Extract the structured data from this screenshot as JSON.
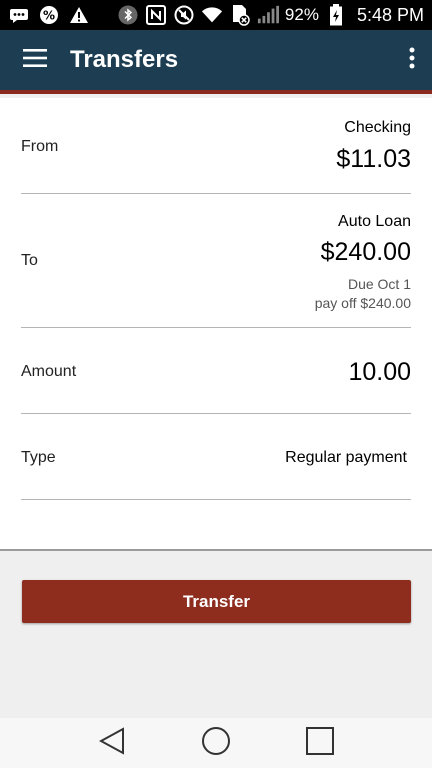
{
  "status_bar": {
    "icons_left": [
      "notification-icon",
      "percent-icon",
      "alert-icon"
    ],
    "icons_right": [
      "bluetooth-icon",
      "nfc-icon",
      "mute-icon",
      "wifi-icon",
      "sim-icon",
      "signal-icon"
    ],
    "battery_percent": "92%",
    "time": "5:48 PM"
  },
  "app_bar": {
    "title": "Transfers",
    "menu_icon": "hamburger-menu-icon",
    "more_icon": "more-vertical-icon"
  },
  "form": {
    "from": {
      "label": "From",
      "account": "Checking",
      "balance": "$11.03"
    },
    "to": {
      "label": "To",
      "account": "Auto Loan",
      "balance": "$240.00",
      "due": "Due Oct 1",
      "payoff": "pay off $240.00"
    },
    "amount": {
      "label": "Amount",
      "value": "10.00"
    },
    "type": {
      "label": "Type",
      "value": "Regular payment"
    }
  },
  "actions": {
    "transfer_label": "Transfer"
  },
  "nav_bar": {
    "icons": [
      "back-icon",
      "home-icon",
      "recents-icon"
    ]
  },
  "colors": {
    "app_bar": "#1c3d52",
    "accent": "#8e2c1e",
    "background": "#efefef"
  }
}
